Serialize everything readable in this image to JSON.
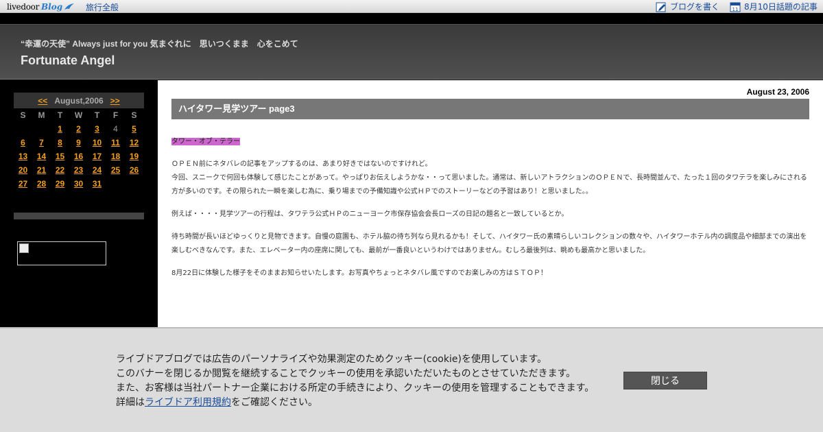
{
  "topbar": {
    "logo_main": "livedoor",
    "logo_blog": "Blog",
    "category": "旅行全般",
    "write_label": "ブログを書く",
    "topic_label": "8月10日話題の記事",
    "calendar_icon_number": "11"
  },
  "header": {
    "tagline": "“幸運の天使” Always just for you 気まぐれに　思いつくまま　心をこめて",
    "title": "Fortunate Angel"
  },
  "calendar": {
    "prev": "<<",
    "month": "August,2006",
    "next": ">>",
    "weekdays": [
      "S",
      "M",
      "T",
      "W",
      "T",
      "F",
      "S"
    ],
    "days": [
      "",
      "",
      "1",
      "2",
      "3",
      "4",
      "5",
      "6",
      "7",
      "8",
      "9",
      "10",
      "11",
      "12",
      "13",
      "14",
      "15",
      "16",
      "17",
      "18",
      "19",
      "20",
      "21",
      "22",
      "23",
      "24",
      "25",
      "26",
      "27",
      "28",
      "29",
      "30",
      "31",
      "",
      ""
    ],
    "unlinked": [
      "4"
    ]
  },
  "post": {
    "date": "August 23, 2006",
    "title": "ハイタワー見学ツアー page3",
    "highlight": "タワー・オブ・テラー",
    "p1_line1": "ＯＰＥＮ前にネタバレの記事をアップするのは、あまり好きではないのですけれど。",
    "p1_line2": "今回、スニークで何回も体験して感じたことがあって。やっぱりお伝えしようかな・・って思いました。通常は、新しいアトラクションのＯＰＥＮで、長時間並んで、たった１回のタワテラを楽しみにされる方が多いのです。その限られた一瞬を楽しむ為に、乗り場までの予備知識や公式ＨＰでのストーリーなどの予習はあり！と思いました。。",
    "p2": "例えば・・・・見学ツアーの行程は、タワテラ公式ＨＰのニューヨーク市保存協会会長ローズの日記の題名と一致しているとか。",
    "p3": "待ち時間が長いほどゆっくりと見物できます。自慢の庭園も、ホテル脇の待ち列なら見れるかも！そして、ハイタワー氏の素晴らしいコレクションの数々や、ハイタワーホテル内の調度品や細部までの演出を楽しむべきなんです。また、エレベーター内の座席に関しても、最前が一番良いというわけではありません。むしろ最後列は、眺めも最高かと思いました。",
    "p4": "8月22日に体験した様子をそのままお知らせいたします。お写真やちょっとネタバレ風ですのでお楽しみの方はＳＴＯＰ！"
  },
  "cookie": {
    "line1": "ライブドアブログでは広告のパーソナライズや効果測定のためクッキー(cookie)を使用しています。",
    "line2": "このバナーを閉じるか閲覧を継続することでクッキーの使用を承認いただいたものとさせていただきます。",
    "line3": "また、お客様は当社パートナー企業における所定の手続きにより、クッキーの使用を管理することもできます。",
    "line4_pre": "詳細は",
    "line4_link": "ライブドア利用規約",
    "line4_post": "をご確認ください。",
    "close_label": "閉じる"
  }
}
